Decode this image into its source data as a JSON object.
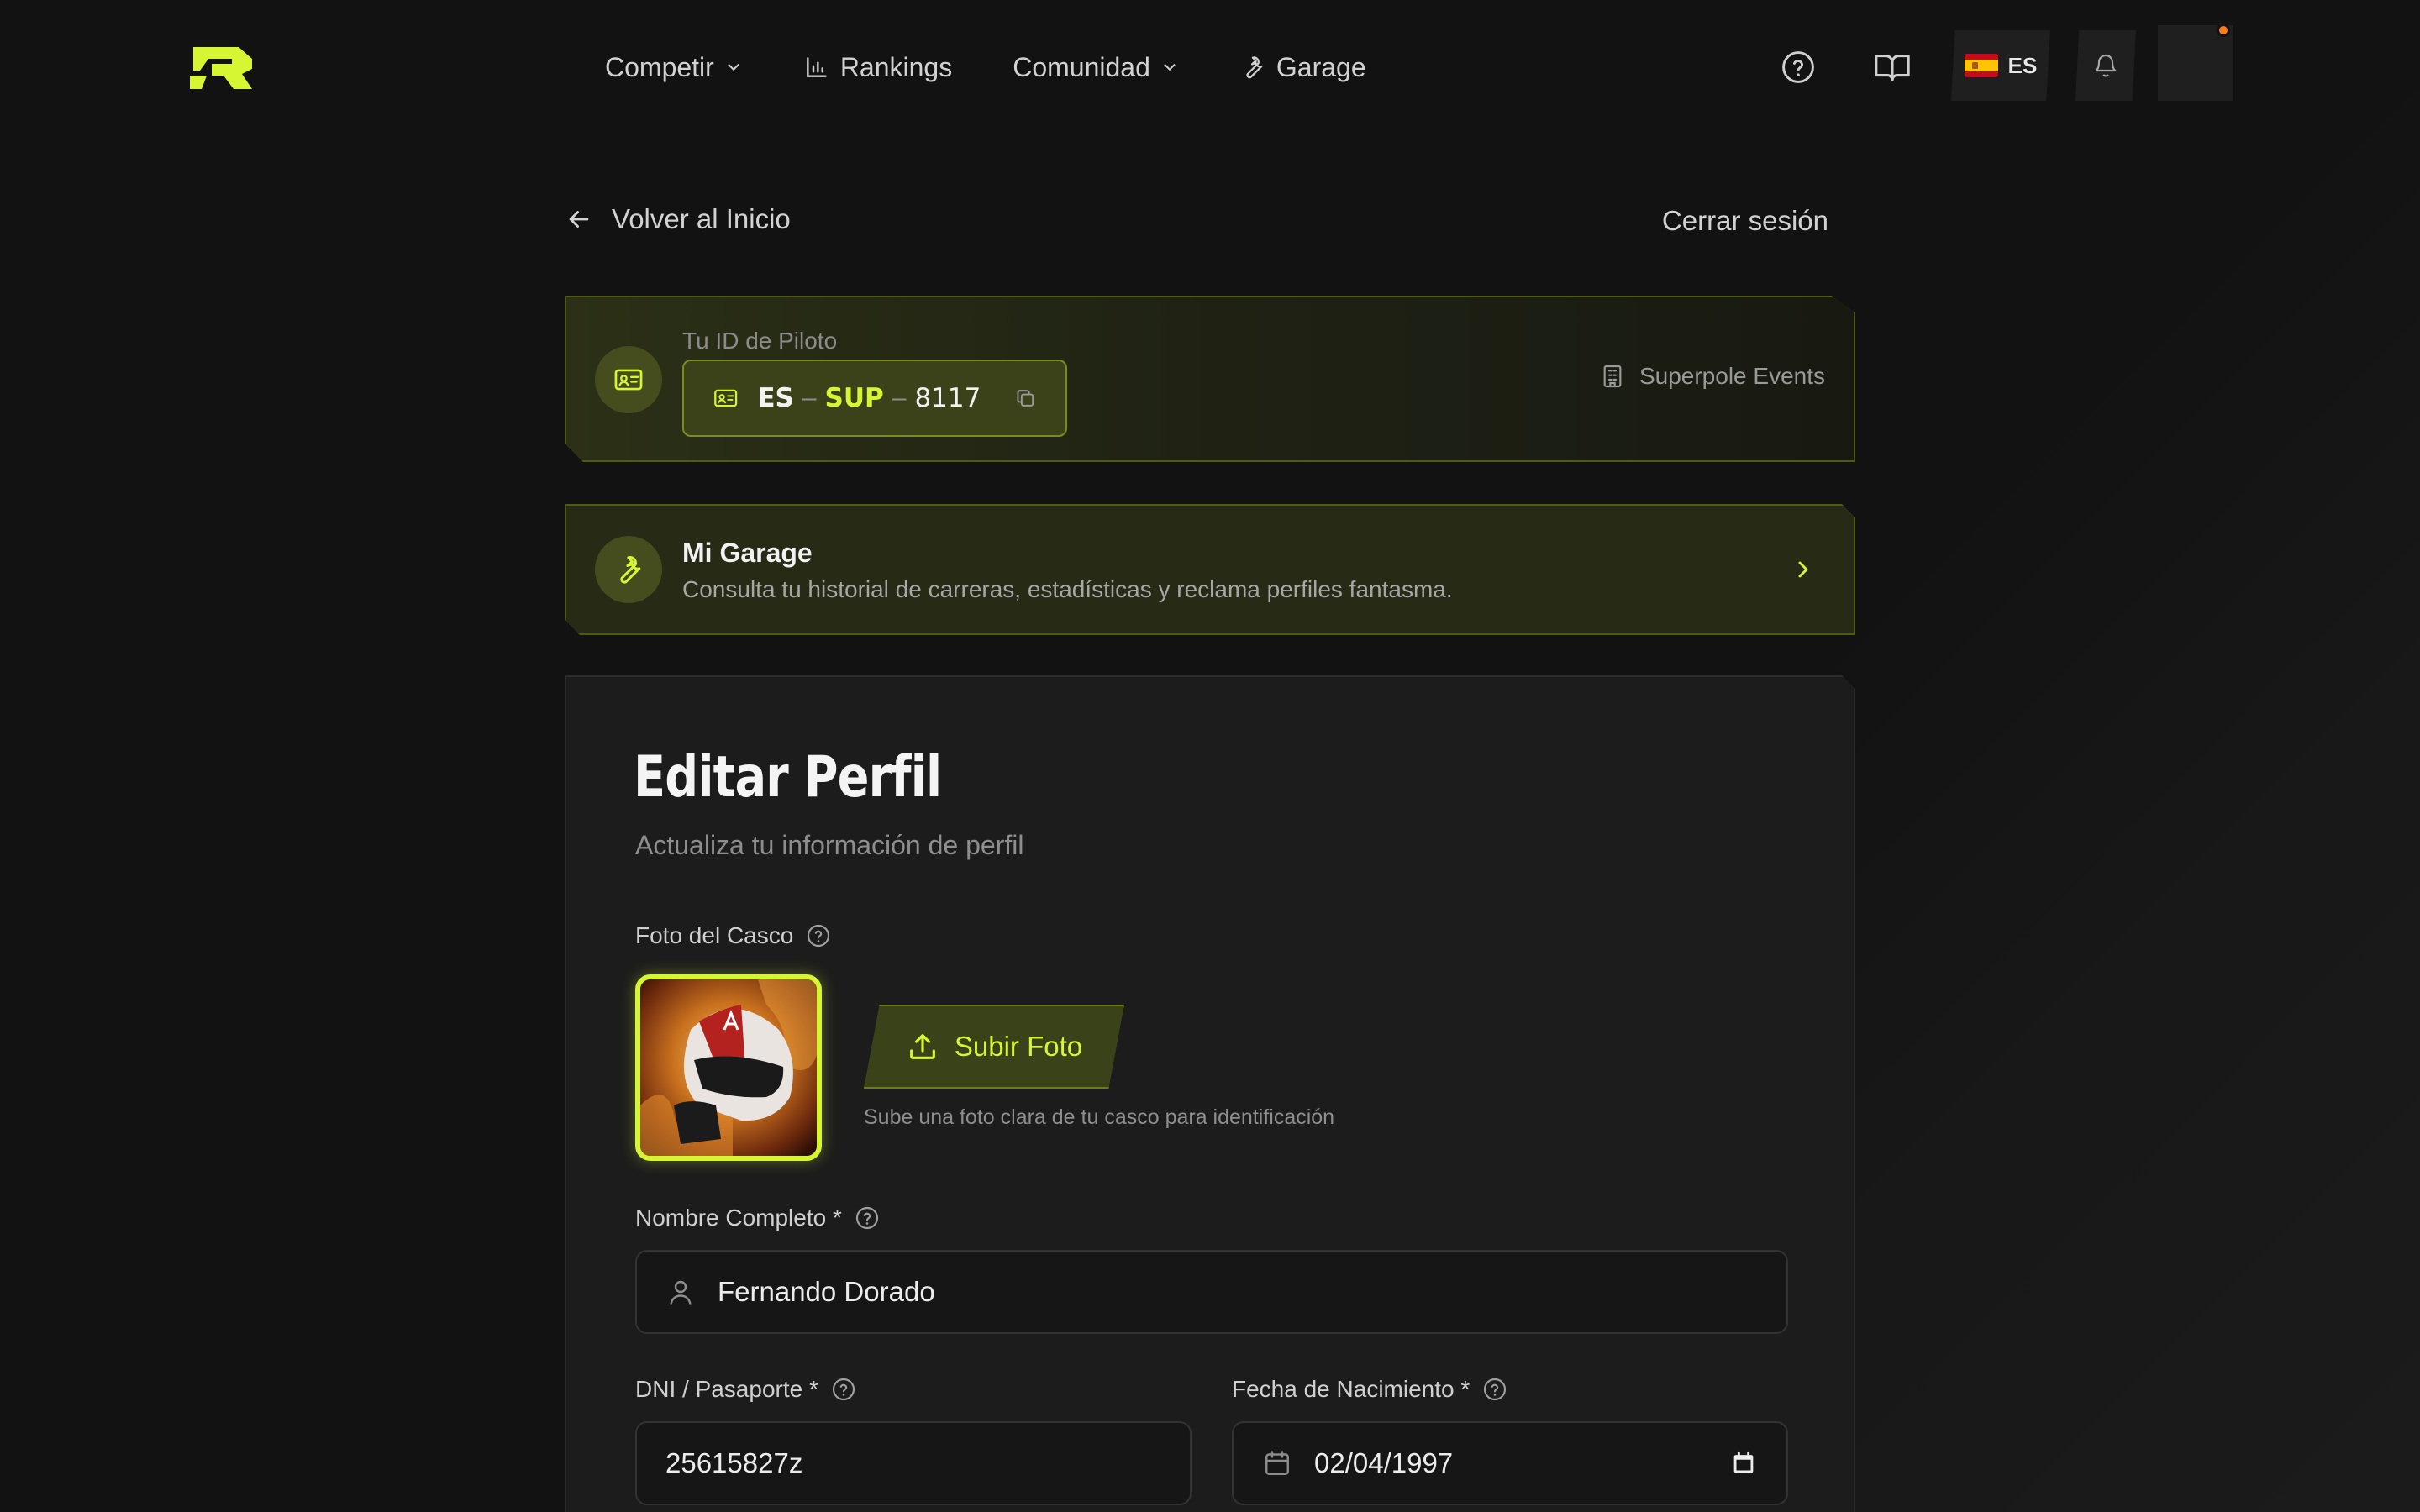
{
  "nav": {
    "items": [
      {
        "label": "Competir",
        "has_dropdown": true
      },
      {
        "label": "Rankings",
        "icon": "bar-chart-icon"
      },
      {
        "label": "Comunidad",
        "has_dropdown": true
      },
      {
        "label": "Garage",
        "icon": "wrench-icon"
      }
    ],
    "language": "ES"
  },
  "profile": {
    "back_label": "Volver al Inicio",
    "logout_label": "Cerrar sesión"
  },
  "pilot_id": {
    "label": "Tu ID de Piloto",
    "country": "ES",
    "separator": "–",
    "code": "SUP",
    "number": "8117",
    "organization": "Superpole Events"
  },
  "garage": {
    "title": "Mi Garage",
    "subtitle": "Consulta tu historial de carreras, estadísticas y reclama perfiles fantasma."
  },
  "form": {
    "title": "Editar Perfil",
    "subtitle": "Actualiza tu información de perfil",
    "photo_label": "Foto del Casco",
    "upload_label": "Subir Foto",
    "upload_hint": "Sube una foto clara de tu casco para identificación",
    "name_label": "Nombre Completo *",
    "name_value": "Fernando Dorado",
    "dni_label": "DNI / Pasaporte *",
    "dni_value": "25615827z",
    "birth_label": "Fecha de Nacimiento *",
    "birth_value": "02/04/1997"
  },
  "colors": {
    "accent": "#d6f532",
    "background": "#121212",
    "card": "#1c1c1c",
    "notification": "#ff7a1a"
  }
}
